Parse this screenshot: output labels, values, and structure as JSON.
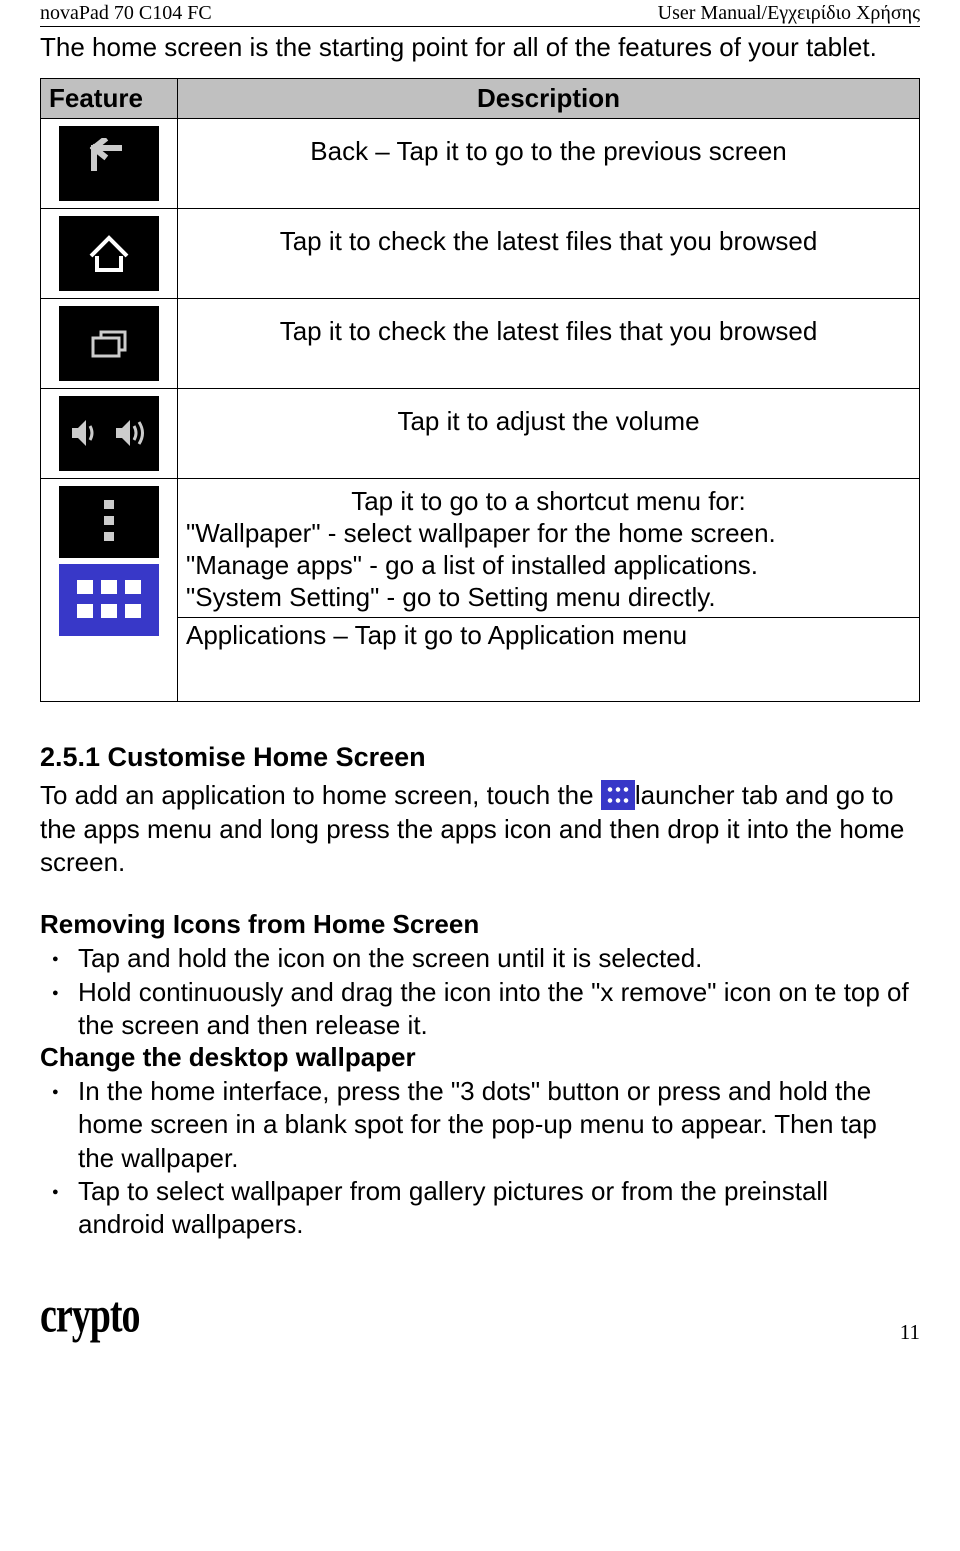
{
  "header": {
    "left": "novaPad 70 C104 FC",
    "right": "User Manual/Εγχειρίδιο Χρήσης"
  },
  "intro": "The home screen is the starting point for all of the features of your tablet.",
  "table": {
    "col1": "Feature",
    "col2": "Description",
    "rows": {
      "r1": "Back – Tap it to go to the previous screen",
      "r2": "Tap it to check the latest files that you browsed",
      "r3": "Tap it to check the latest files that you browsed",
      "r4": "Tap it to adjust the volume",
      "r5a": "Tap it to go to a shortcut menu for:",
      "r5b": "\"Wallpaper\" - select wallpaper for the home screen.",
      "r5c": "\"Manage apps\" - go a list of installed applications.",
      "r5d": "\"System Setting\" - go to Setting menu directly.",
      "r6": "Applications – Tap it go to Application menu"
    }
  },
  "section": {
    "title": "2.5.1 Customise Home Screen",
    "p1a": "To add an application to home screen, touch the ",
    "p1b": "launcher tab and go to the apps menu and long press the apps icon and then drop it into the home screen."
  },
  "removing": {
    "title": "Removing Icons from Home Screen",
    "li1": "Tap and hold the icon on the screen until it is selected.",
    "li2": "Hold continuously and drag the icon into the \"x remove\" icon on te top of the screen and then release it."
  },
  "wallpaper": {
    "title": "Change the desktop wallpaper",
    "li1": "In the home interface, press the \"3 dots\" button or press and hold the home screen in  a blank spot  for the  pop-up menu to appear. Then tap the wallpaper.",
    "li2": "Tap to select wallpaper from gallery pictures or from the preinstall android wallpapers."
  },
  "footer": {
    "logo": "crypto",
    "page": "11"
  }
}
